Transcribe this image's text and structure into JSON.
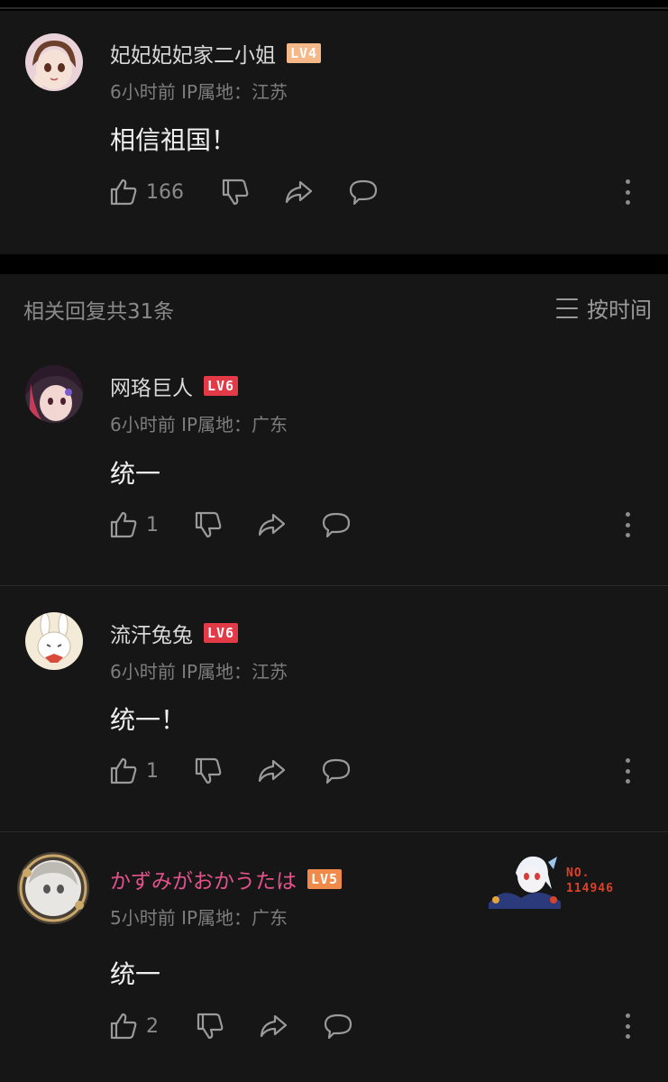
{
  "main_comment": {
    "username": "妃妃妃妃家二小姐",
    "level": "LV4",
    "time": "6小时前",
    "ip": "IP属地：江苏",
    "content": "相信祖国！",
    "likes": "166"
  },
  "replies_header": {
    "count_label": "相关回复共31条",
    "sort_label": "按时间"
  },
  "replies": [
    {
      "username": "网珞巨人",
      "level": "LV6",
      "time": "6小时前",
      "ip": "IP属地：广东",
      "content": "统一",
      "likes": "1"
    },
    {
      "username": "流汗兔兔",
      "level": "LV6",
      "time": "6小时前",
      "ip": "IP属地：江苏",
      "content": "统一！",
      "likes": "1"
    },
    {
      "username": "かずみがおかうたは",
      "level": "LV5",
      "time": "5小时前",
      "ip": "IP属地：广东",
      "content": "统一",
      "likes": "2",
      "badge_no": "NO.",
      "badge_num": "114946"
    }
  ],
  "colors": {
    "background": "#161616",
    "accent_pink": "#e4528b",
    "lv6": "#e23a46",
    "lv4": "#f5b888",
    "lv5": "#f08a4b"
  },
  "icons": [
    "thumb-up-icon",
    "thumb-down-icon",
    "share-icon",
    "comment-icon",
    "more-icon",
    "sort-icon"
  ]
}
